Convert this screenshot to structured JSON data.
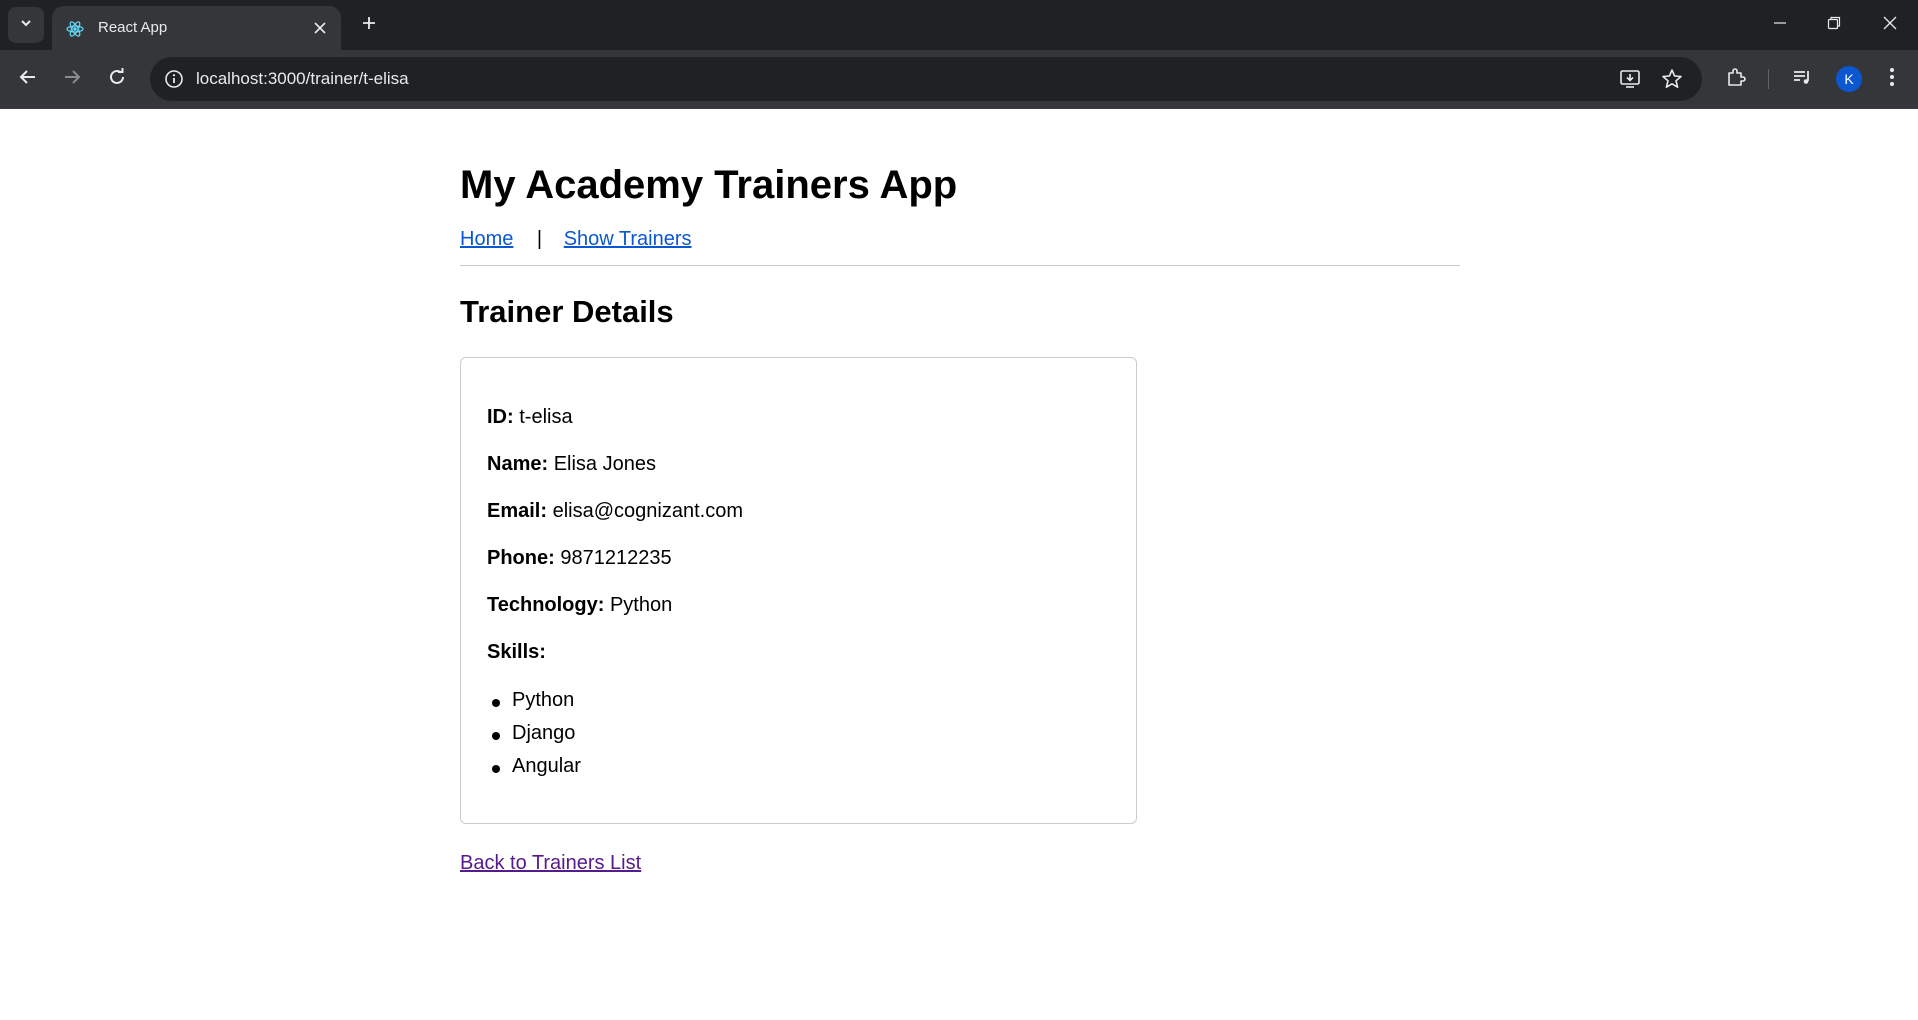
{
  "browser": {
    "tab_title": "React App",
    "url": "localhost:3000/trainer/t-elisa",
    "avatar_letter": "K",
    "icons": {
      "tab_search": "chevron-down-icon",
      "favicon": "react-logo-icon",
      "tab_close": "close-icon",
      "new_tab": "plus-icon",
      "minimize": "minimize-icon",
      "restore": "restore-icon",
      "close_window": "close-icon",
      "back": "arrow-left-icon",
      "forward": "arrow-right-icon",
      "reload": "reload-icon",
      "site_info": "info-icon",
      "install": "install-icon",
      "bookmark": "star-icon",
      "extensions": "puzzle-icon",
      "media": "media-queue-icon",
      "menu": "kebab-menu-icon"
    }
  },
  "page": {
    "app_title": "My Academy Trainers App",
    "nav": {
      "home_label": "Home",
      "separator": "|",
      "trainers_label": "Show Trainers"
    },
    "section_title": "Trainer Details",
    "details": {
      "id_label": "ID:",
      "id_value": "t-elisa",
      "name_label": "Name:",
      "name_value": "Elisa Jones",
      "email_label": "Email:",
      "email_value": "elisa@cognizant.com",
      "phone_label": "Phone:",
      "phone_value": "9871212235",
      "technology_label": "Technology:",
      "technology_value": "Python",
      "skills_label": "Skills:",
      "skills": [
        "Python",
        "Django",
        "Angular"
      ]
    },
    "back_link": "Back to Trainers List"
  },
  "colors": {
    "chrome_dark": "#202124",
    "chrome_toolbar": "#35363a",
    "link": "#0b57d0",
    "visited_link": "#551a8b",
    "avatar": "#0b57d0"
  }
}
